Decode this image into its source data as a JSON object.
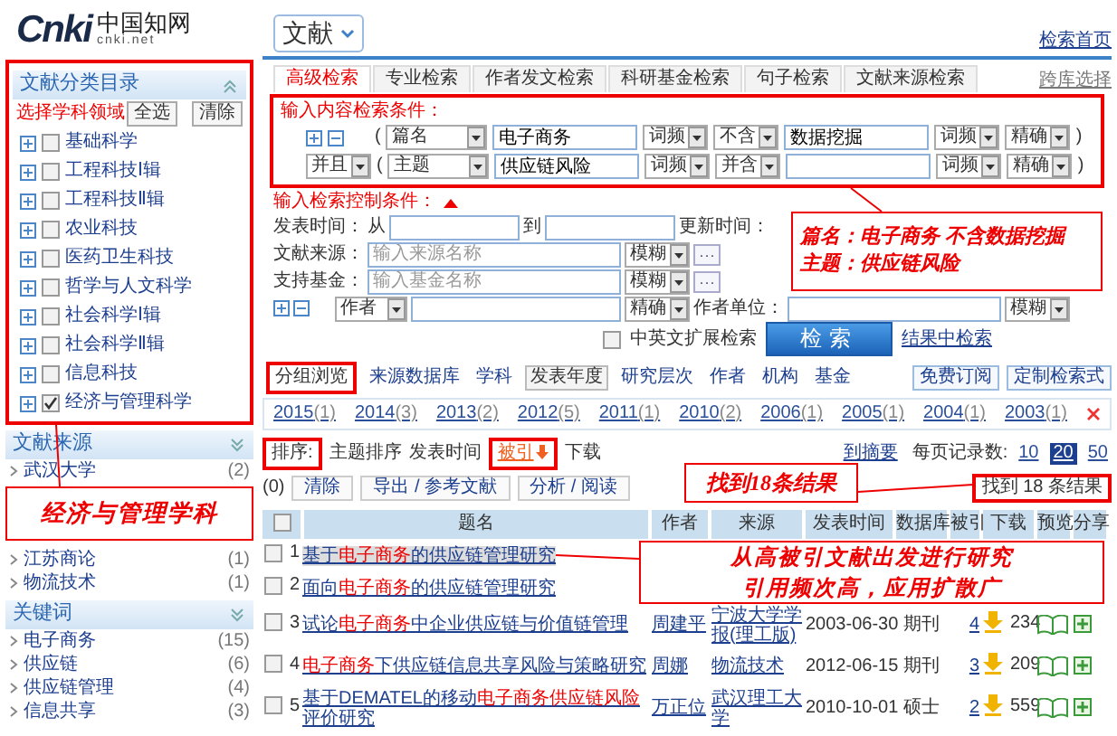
{
  "logo": {
    "brand": "Cnki",
    "name": "中国知网",
    "domain": "cnki.net"
  },
  "sidebar": {
    "catalog": {
      "title": "文献分类目录",
      "hint": "选择学科领域",
      "buttons": [
        "全选",
        "清除"
      ],
      "boxed": true,
      "items": [
        {
          "label": "基础科学",
          "checked": false
        },
        {
          "label": "工程科技Ⅰ辑",
          "checked": false
        },
        {
          "label": "工程科技Ⅱ辑",
          "checked": false
        },
        {
          "label": "农业科技",
          "checked": false
        },
        {
          "label": "医药卫生科技",
          "checked": false
        },
        {
          "label": "哲学与人文科学",
          "checked": false
        },
        {
          "label": "社会科学Ⅰ辑",
          "checked": false
        },
        {
          "label": "社会科学Ⅱ辑",
          "checked": false
        },
        {
          "label": "信息科技",
          "checked": false
        },
        {
          "label": "经济与管理科学",
          "checked": true
        }
      ]
    },
    "sources": {
      "title": "文献来源",
      "items": [
        {
          "label": "武汉大学",
          "count": "(2)"
        },
        {
          "label": "江苏商论",
          "count": "(1)"
        },
        {
          "label": "物流技术",
          "count": "(1)"
        }
      ]
    },
    "keywords": {
      "title": "关键词",
      "items": [
        {
          "label": "电子商务",
          "count": "(15)"
        },
        {
          "label": "供应链",
          "count": "(6)"
        },
        {
          "label": "供应链管理",
          "count": "(4)"
        },
        {
          "label": "信息共享",
          "count": "(3)"
        }
      ]
    }
  },
  "header": {
    "database": "文献",
    "home_link": "检索首页"
  },
  "search_tabs": [
    {
      "label": "高级检索",
      "selected": true
    },
    {
      "label": "专业检索",
      "selected": false
    },
    {
      "label": "作者发文检索",
      "selected": false
    },
    {
      "label": "科研基金检索",
      "selected": false
    },
    {
      "label": "句子检索",
      "selected": false
    },
    {
      "label": "文献来源检索",
      "selected": false
    }
  ],
  "cross_db_link": "跨库选择",
  "content_conditions": {
    "title": "输入内容检索条件：",
    "boxed": true,
    "rows": [
      {
        "kind": "first",
        "open": "(",
        "field": "篇名",
        "term": "电子商务",
        "freq": "词频",
        "relation": "不含",
        "term2": "数据挖掘",
        "freq2": "词频",
        "match": "精确",
        "close": ")"
      },
      {
        "kind": "next",
        "logic": "并且",
        "open": "(",
        "field": "主题",
        "term": "供应链风险",
        "freq": "词频",
        "relation": "并含",
        "freq2": "词频",
        "match": "精确",
        "close": ")"
      }
    ]
  },
  "control_conditions": {
    "title": "输入检索控制条件：",
    "date_label": "发表时间：",
    "from": "从",
    "to": "到",
    "update_label": "更新时间：",
    "source_label": "文献来源：",
    "source_placeholder": "输入来源名称",
    "source_match": "模糊",
    "fund_label": "支持基金：",
    "fund_placeholder": "输入基金名称",
    "fund_match": "模糊",
    "more_button": "···",
    "author_field": "作者",
    "author_match": "精确",
    "affiliation_label": "作者单位：",
    "affiliation_match": "模糊",
    "expand_label": "中英文扩展检索",
    "expand_checked": false,
    "search_button": "检索",
    "in_results_link": "结果中检索"
  },
  "group_label": "分组浏览",
  "group_label_boxed": true,
  "group_tabs": [
    {
      "label": "来源数据库",
      "selected": false
    },
    {
      "label": "学科",
      "selected": false
    },
    {
      "label": "发表年度",
      "selected": true
    },
    {
      "label": "研究层次",
      "selected": false
    },
    {
      "label": "作者",
      "selected": false
    },
    {
      "label": "机构",
      "selected": false
    },
    {
      "label": "基金",
      "selected": false
    }
  ],
  "group_buttons": [
    "免费订阅",
    "定制检索式"
  ],
  "years": [
    {
      "year": "2015",
      "count": "(1)"
    },
    {
      "year": "2014",
      "count": "(3)"
    },
    {
      "year": "2013",
      "count": "(2)"
    },
    {
      "year": "2012",
      "count": "(5)"
    },
    {
      "year": "2011",
      "count": "(1)"
    },
    {
      "year": "2010",
      "count": "(2)"
    },
    {
      "year": "2006",
      "count": "(1)"
    },
    {
      "year": "2005",
      "count": "(1)"
    },
    {
      "year": "2004",
      "count": "(1)"
    },
    {
      "year": "2003",
      "count": "(1)"
    }
  ],
  "sort": {
    "label": "排序:",
    "label_boxed": true,
    "options": [
      {
        "label": "主题排序",
        "selected": false,
        "boxed": false
      },
      {
        "label": "发表时间",
        "selected": false,
        "boxed": false
      },
      {
        "label": "被引",
        "selected": true,
        "boxed": true
      },
      {
        "label": "下载",
        "selected": false,
        "boxed": false
      }
    ],
    "abstract_link": "到摘要",
    "per_page_label": "每页记录数:",
    "per_page": [
      {
        "value": "10",
        "selected": false
      },
      {
        "value": "20",
        "selected": true
      },
      {
        "value": "50",
        "selected": false
      }
    ]
  },
  "toolbar": {
    "count": "(0)",
    "buttons": [
      "清除",
      "导出 / 参考文献",
      "分析 / 阅读"
    ],
    "result_count": "找到 18 条结果",
    "result_boxed": true
  },
  "table": {
    "select_all_checked": false,
    "columns": [
      "题名",
      "作者",
      "来源",
      "发表时间",
      "数据库",
      "被引",
      "下载",
      "预览",
      "分享"
    ],
    "rows": [
      {
        "index": "1",
        "checked": false,
        "selected": true,
        "title": [
          {
            "text": "基于",
            "hit": false
          },
          {
            "text": "电子商务",
            "hit": true
          },
          {
            "text": "的供应链管理研究",
            "hit": false
          }
        ]
      },
      {
        "index": "2",
        "checked": false,
        "selected": false,
        "title": [
          {
            "text": "面向",
            "hit": false
          },
          {
            "text": "电子商务",
            "hit": true
          },
          {
            "text": "的供应链管理研究",
            "hit": false
          }
        ]
      },
      {
        "index": "3",
        "checked": false,
        "selected": false,
        "title": [
          {
            "text": "试论",
            "hit": false
          },
          {
            "text": "电子商务",
            "hit": true
          },
          {
            "text": "中企业供应链与价值链管理",
            "hit": false
          }
        ],
        "author": "周建平",
        "source": "宁波大学学报(理工版)",
        "date": "2003-06-30",
        "database": "期刊",
        "cited": "4",
        "downloads": "234"
      },
      {
        "index": "4",
        "checked": false,
        "selected": false,
        "title": [
          {
            "text": "电子商务",
            "hit": true
          },
          {
            "text": "下供应链信息共享风险与策略研究",
            "hit": false
          }
        ],
        "author": "周娜",
        "source": "物流技术",
        "date": "2012-06-15",
        "database": "期刊",
        "cited": "3",
        "downloads": "209"
      },
      {
        "index": "5",
        "checked": false,
        "selected": false,
        "title": [
          {
            "text": "基于DEMATEL的移动",
            "hit": false
          },
          {
            "text": "电子商务供应链风险",
            "hit": true
          },
          {
            "text": "评价研究",
            "hit": false
          }
        ],
        "author": "万正位",
        "source": "武汉理工大学",
        "date": "2010-10-01",
        "database": "硕士",
        "cited": "2",
        "downloads": "559"
      }
    ]
  },
  "annotations": [
    {
      "lines": [
        "经济与管理学科"
      ]
    },
    {
      "lines": [
        "篇名：电子商务 不含数据挖掘",
        "主题：供应链风险"
      ]
    },
    {
      "lines": [
        "找到18条结果"
      ]
    },
    {
      "lines": [
        "从高被引文献出发进行研究",
        "引用频次高，应用扩散广"
      ]
    }
  ]
}
